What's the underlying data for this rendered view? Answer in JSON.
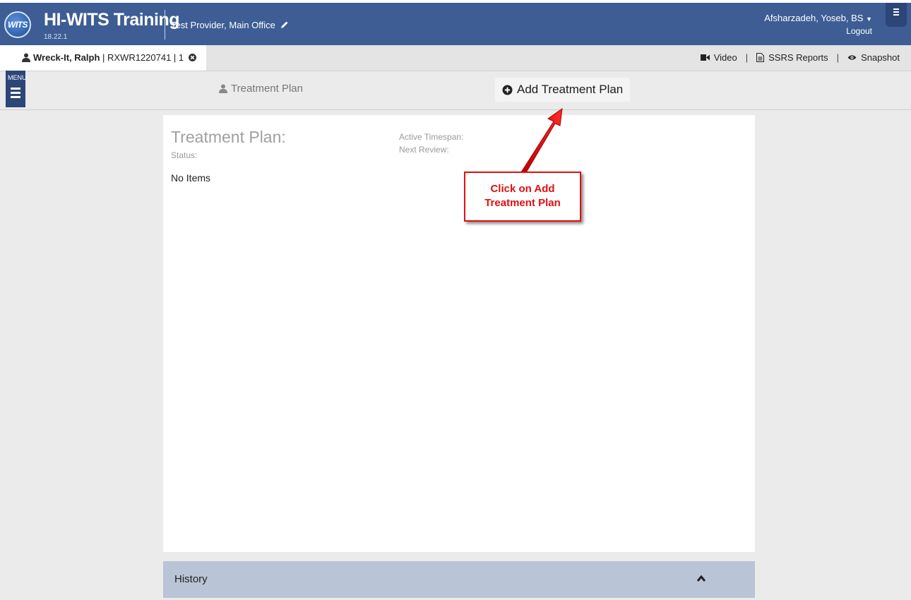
{
  "header": {
    "logo_text": "WITS",
    "app_title": "HI-WITS Training",
    "version": "18.22.1",
    "provider": "Test Provider, Main Office",
    "user": "Afsharzadeh, Yoseb, BS",
    "logout": "Logout",
    "icons": [
      "pencil-icon",
      "caret-down-icon",
      "hamburger-icon"
    ],
    "colors": {
      "header_bg": "#3d5d94",
      "menu_bg": "#2b4677"
    }
  },
  "client_tab": {
    "name": "Wreck-It, Ralph",
    "id_text": " | RXWR1220741 | 1"
  },
  "top_links": {
    "video": "Video",
    "ssrs": "SSRS Reports",
    "snapshot": "Snapshot",
    "separator": "|"
  },
  "menu": {
    "label": "MENU"
  },
  "subnav": {
    "treatment_plan": "Treatment Plan",
    "add_treatment_plan": "Add Treatment Plan"
  },
  "panel": {
    "title": "Treatment Plan:",
    "status_label": "Status:",
    "active_timespan_label": "Active Timespan:",
    "next_review_label": "Next Review:",
    "empty_text": "No Items"
  },
  "history": {
    "label": "History"
  },
  "annotation": {
    "line1": "Click on Add",
    "line2": "Treatment Plan",
    "color": "#e01010"
  }
}
